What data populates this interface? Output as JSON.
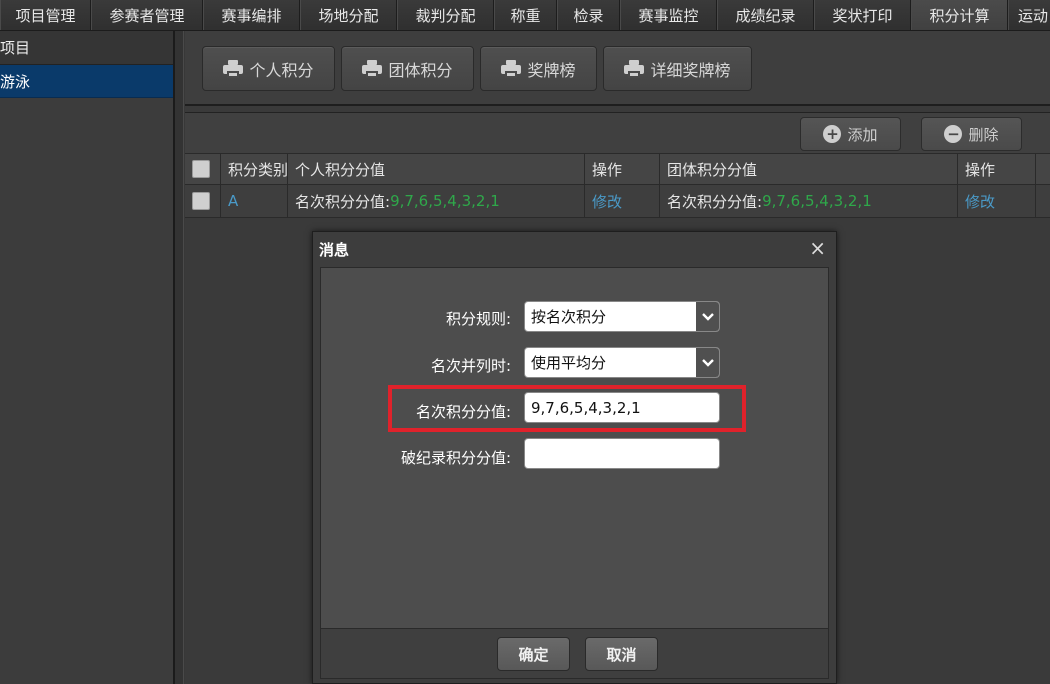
{
  "top_tabs": [
    "项目管理",
    "参赛者管理",
    "赛事编排",
    "场地分配",
    "裁判分配",
    "称重",
    "检录",
    "赛事监控",
    "成绩纪录",
    "奖状打印",
    "积分计算",
    "运动"
  ],
  "active_tab_index": 10,
  "sidebar": {
    "header": "项目",
    "items": [
      {
        "label": "游泳",
        "selected": true
      }
    ]
  },
  "toolbar": {
    "buttons": [
      "个人积分",
      "团体积分",
      "奖牌榜",
      "详细奖牌榜"
    ]
  },
  "grid": {
    "add_label": "添加",
    "delete_label": "删除",
    "columns": [
      "积分类别",
      "个人积分分值",
      "操作",
      "团体积分分值",
      "操作"
    ],
    "rows": [
      {
        "category": "A",
        "personal_prefix": "名次积分分值:",
        "personal_values": "9,7,6,5,4,3,2,1",
        "action1": "修改",
        "team_prefix": "名次积分分值:",
        "team_values": "9,7,6,5,4,3,2,1",
        "action2": "修改"
      }
    ]
  },
  "dialog": {
    "title": "消息",
    "close_symbol": "×",
    "fields": {
      "rule_label": "积分规则:",
      "rule_value": "按名次积分",
      "tie_label": "名次并列时:",
      "tie_value": "使用平均分",
      "rank_label": "名次积分分值:",
      "rank_value": "9,7,6,5,4,3,2,1",
      "record_label": "破纪录积分分值:",
      "record_value": ""
    },
    "ok_label": "确定",
    "cancel_label": "取消"
  },
  "colors": {
    "highlight": "#e0222b",
    "link": "#4a9ac8",
    "value_green": "#2fa84a",
    "selected_bg": "#0a3a6a"
  }
}
